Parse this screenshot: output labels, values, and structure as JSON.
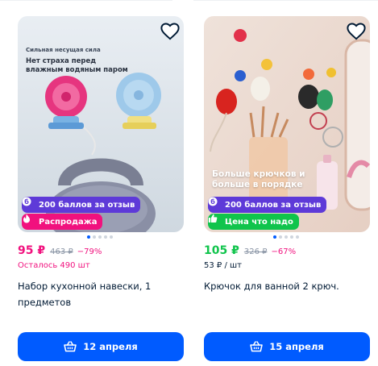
{
  "colors": {
    "accent": "#005bff",
    "sale_pink": "#f1117e",
    "good_green": "#10c44c",
    "points_purple": "#5e3ad8"
  },
  "products": [
    {
      "image_caption_small": "Сильная несущая сила",
      "image_caption_big": "Нет страха перед влажным водяным паром",
      "points_badge": "200 баллов за отзыв",
      "promo_badge": "Распродажа",
      "price": "95 ₽",
      "old_price": "463 ₽",
      "discount": "−79%",
      "sub_text": "Осталось 490 шт",
      "title": "Набор кухонной навески, 1 предметов",
      "delivery_button": "12 апреля",
      "gallery_dots": 5,
      "gallery_active": 0
    },
    {
      "image_caption_big": "Больше крючков и больше в порядке",
      "points_badge": "200 баллов за отзыв",
      "promo_badge": "Цена что надо",
      "price": "105 ₽",
      "old_price": "326 ₽",
      "discount": "−67%",
      "sub_text": "53 ₽ / шт",
      "title": "Крючок для ванной 2 крюч.",
      "delivery_button": "15 апреля",
      "gallery_dots": 5,
      "gallery_active": 0
    }
  ]
}
